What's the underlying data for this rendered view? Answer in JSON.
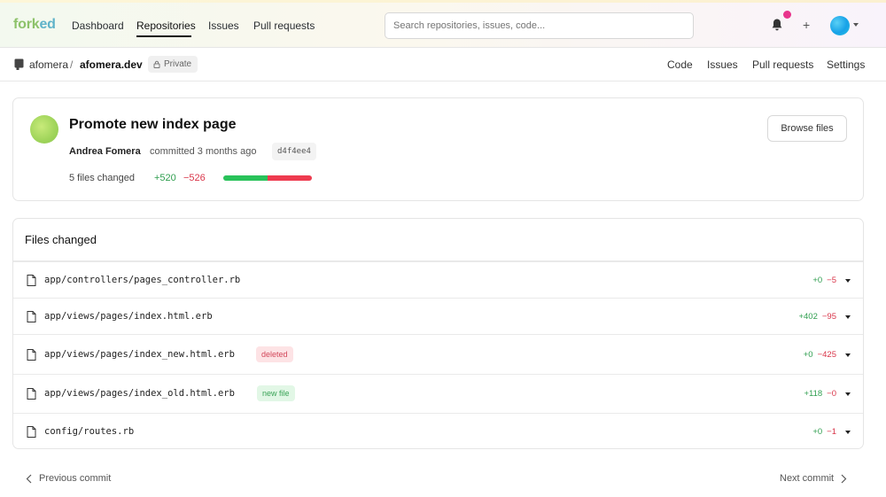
{
  "header": {
    "logo_part1": "fork",
    "logo_part2": "ed",
    "nav": [
      {
        "label": "Dashboard"
      },
      {
        "label": "Repositories"
      },
      {
        "label": "Issues"
      },
      {
        "label": "Pull requests"
      }
    ],
    "search_placeholder": "Search repositories, issues, code...",
    "plus": "+"
  },
  "repo": {
    "owner": "afomera",
    "separator": "/",
    "name": "afomera.dev",
    "visibility": "Private",
    "nav": [
      {
        "label": "Code"
      },
      {
        "label": "Issues"
      },
      {
        "label": "Pull requests"
      },
      {
        "label": "Settings"
      }
    ]
  },
  "commit": {
    "title": "Promote new index page",
    "author": "Andrea Fomera",
    "committed": "committed 3 months ago",
    "sha": "d4f4ee4",
    "files_changed": "5 files changed",
    "additions": "+520",
    "deletions": "−526",
    "additions_fraction": 0.497,
    "browse_label": "Browse files"
  },
  "files": {
    "heading": "Files changed",
    "items": [
      {
        "path": "app/controllers/pages_controller.rb",
        "badge": "",
        "add": "+0",
        "del": "−5"
      },
      {
        "path": "app/views/pages/index.html.erb",
        "badge": "",
        "add": "+402",
        "del": "−95"
      },
      {
        "path": "app/views/pages/index_new.html.erb",
        "badge": "deleted",
        "add": "+0",
        "del": "−425"
      },
      {
        "path": "app/views/pages/index_old.html.erb",
        "badge": "new file",
        "add": "+118",
        "del": "−0"
      },
      {
        "path": "config/routes.rb",
        "badge": "",
        "add": "+0",
        "del": "−1"
      }
    ]
  },
  "pager": {
    "previous": "Previous commit",
    "next": "Next commit"
  },
  "colors": {
    "accent_green": "#29c25a",
    "accent_red": "#ee3b4f",
    "notification_dot": "#e8348c"
  }
}
